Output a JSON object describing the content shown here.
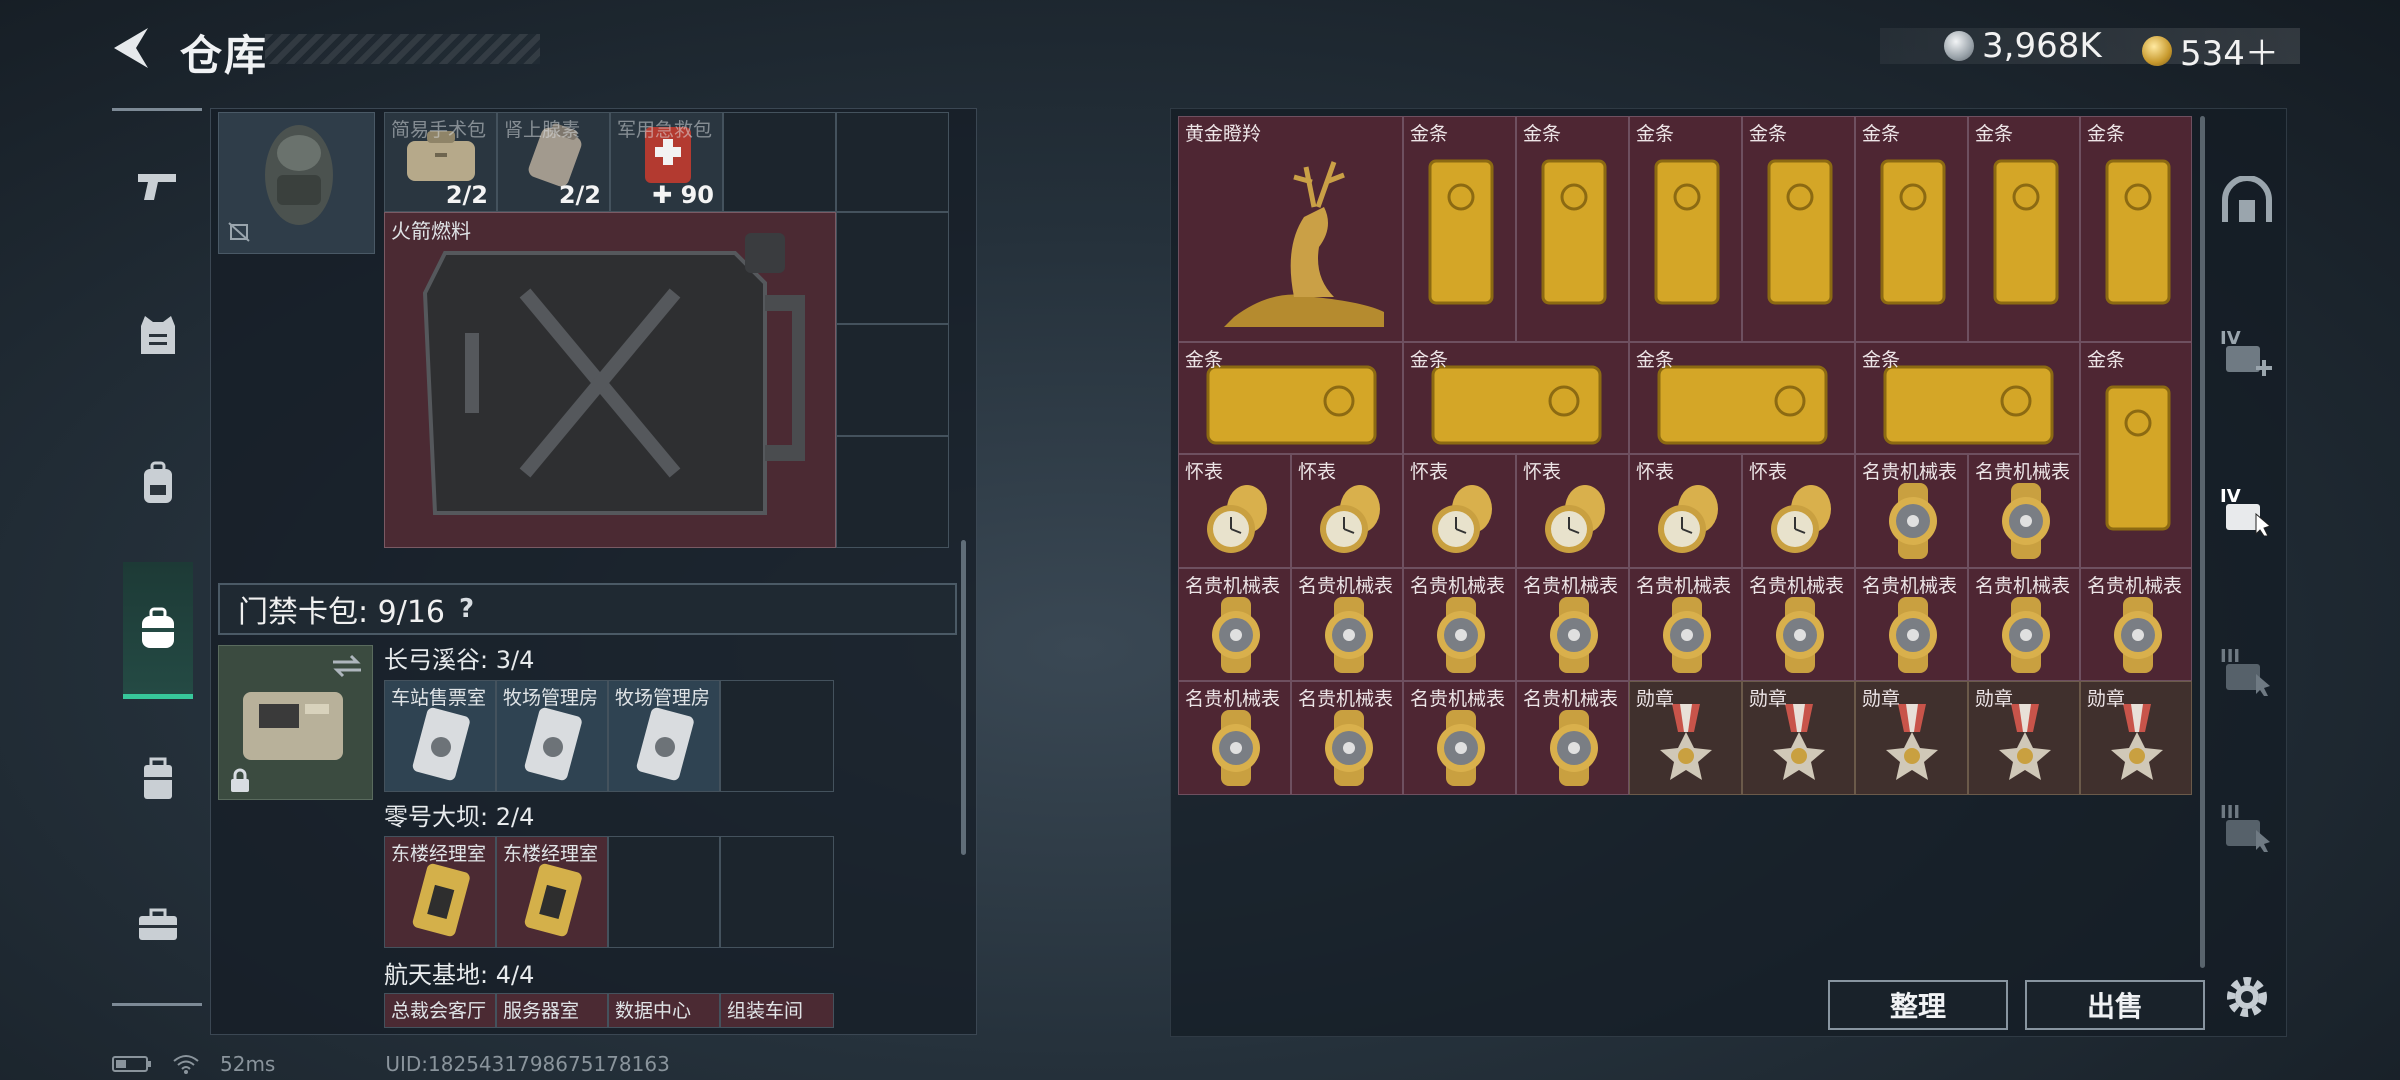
{
  "header": {
    "title": "仓库",
    "currency_silver": "3,968K",
    "currency_gold": "534＋"
  },
  "backpack_section": {
    "items": [
      {
        "label": "简易手术包",
        "count": "2/2"
      },
      {
        "label": "肾上腺素",
        "count": "2/2"
      },
      {
        "label": "军用急救包",
        "count": "✚ 90"
      }
    ],
    "large_item": "火箭燃料"
  },
  "card_pack": {
    "label": "门禁卡包: 9/16",
    "help": "?",
    "sections": [
      {
        "title": "长弓溪谷: 3/4",
        "cards": [
          "车站售票室",
          "牧场管理房",
          "牧场管理房"
        ]
      },
      {
        "title": "零号大坝: 2/4",
        "cards": [
          "东楼经理室",
          "东楼经理室"
        ]
      },
      {
        "title": "航天基地: 4/4",
        "cards": [
          "总裁会客厅",
          "服务器室",
          "数据中心",
          "组装车间"
        ]
      }
    ]
  },
  "inventory": {
    "row1": [
      "黄金瞪羚",
      "金条",
      "金条",
      "金条",
      "金条",
      "金条",
      "金条",
      "金条"
    ],
    "row2": [
      "金条",
      "金条",
      "金条",
      "金条",
      "金条"
    ],
    "row3": [
      "怀表",
      "怀表",
      "怀表",
      "怀表",
      "怀表",
      "怀表",
      "名贵机械表",
      "名贵机械表"
    ],
    "row4": [
      "名贵机械表",
      "名贵机械表",
      "名贵机械表",
      "名贵机械表",
      "名贵机械表",
      "名贵机械表",
      "名贵机械表",
      "名贵机械表",
      "名贵机械表"
    ],
    "row5": [
      "名贵机械表",
      "名贵机械表",
      "名贵机械表",
      "名贵机械表",
      "勋章",
      "勋章",
      "勋章",
      "勋章",
      "勋章"
    ]
  },
  "side_tabs": [
    "IV",
    "IV",
    "III",
    "III"
  ],
  "buttons": {
    "sort": "整理",
    "sell": "出售"
  },
  "status": {
    "ping": "52ms",
    "uid": "UID:1825431798675178163"
  },
  "colors": {
    "accent": "#37c79a",
    "slot_red": "#4e2633",
    "slot_gold": "#d4a627"
  }
}
